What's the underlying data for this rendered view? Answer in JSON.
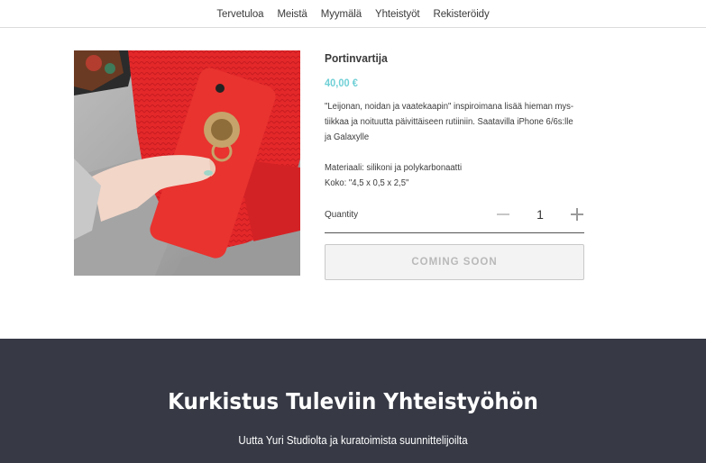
{
  "nav": {
    "items": [
      "Tervetuloa",
      "Meistä",
      "Myymälä",
      "Yhteistyöt",
      "Rekisteröidy"
    ]
  },
  "product": {
    "image_icon": "product-photo-red-phone-case-lion-ring",
    "title": "Portinvartija",
    "price": "40,00 €",
    "price_color": "#6fd0d6",
    "description_lines": [
      "\"Leijonan, noidan ja vaatekaapin\" inspiroimana lisää hieman mys-",
      "tiikkaa ja noituutta päivittäiseen rutiiniin. Saatavilla iPhone 6/6s:lle",
      "ja Galaxylle"
    ],
    "spec_lines": [
      "Materiaali: silikoni ja polykarbonaatti",
      "Koko: \"4,5 x 0,5 x 2,5\""
    ],
    "quantity_label": "Quantity",
    "quantity_value": "1",
    "button_label": "COMING SOON"
  },
  "footer": {
    "background": "#373a45",
    "title": "Kurkistus Tuleviin Yhteistyöhön",
    "subtitle": "Uutta Yuri Studiolta ja kuratoimista suunnittelijoilta"
  }
}
